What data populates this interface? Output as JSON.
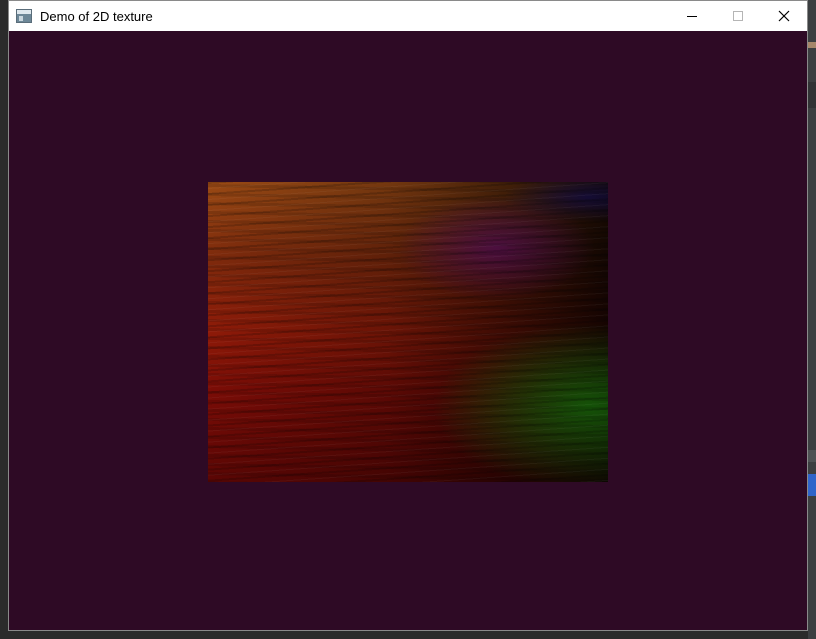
{
  "window": {
    "title": "Demo of 2D texture",
    "controls": {
      "minimize_icon": "minimize-icon",
      "maximize_icon": "maximize-icon",
      "close_icon": "close-icon"
    }
  },
  "canvas": {
    "background_color": "#2e0a25",
    "texture": "wood-texture"
  }
}
